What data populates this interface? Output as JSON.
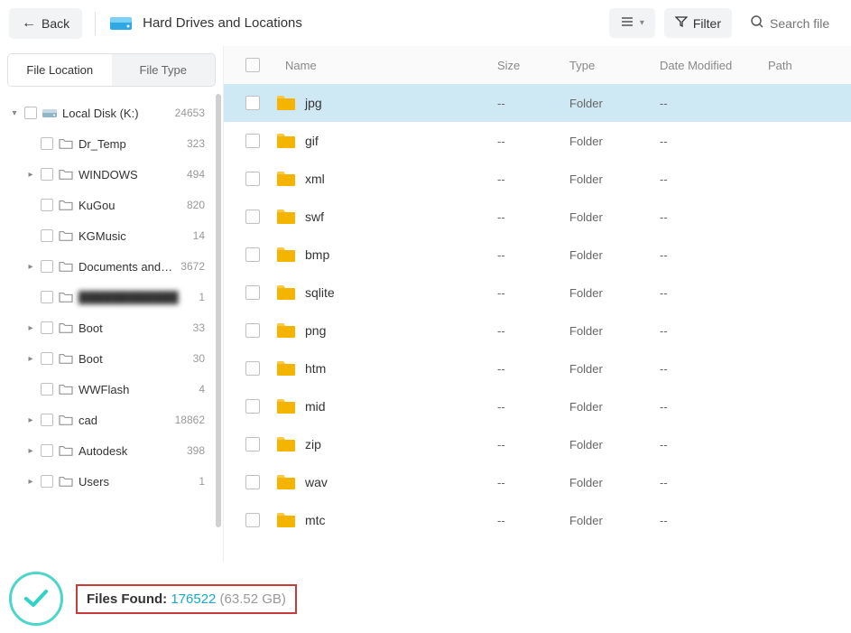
{
  "header": {
    "back_label": "Back",
    "title": "Hard Drives and Locations",
    "filter_label": "Filter",
    "search_placeholder": "Search file"
  },
  "sidebar": {
    "tabs": {
      "location": "File Location",
      "type": "File Type"
    },
    "items": [
      {
        "label": "Local Disk (K:)",
        "count": "24653",
        "icon": "drive",
        "indent": 0,
        "caret": "down"
      },
      {
        "label": "Dr_Temp",
        "count": "323",
        "icon": "folder",
        "indent": 1,
        "caret": ""
      },
      {
        "label": "WINDOWS",
        "count": "494",
        "icon": "folder",
        "indent": 1,
        "caret": "right"
      },
      {
        "label": "KuGou",
        "count": "820",
        "icon": "folder",
        "indent": 1,
        "caret": ""
      },
      {
        "label": "KGMusic",
        "count": "14",
        "icon": "folder",
        "indent": 1,
        "caret": ""
      },
      {
        "label": "Documents and Set...",
        "count": "3672",
        "icon": "folder",
        "indent": 1,
        "caret": "right"
      },
      {
        "label": "████████████",
        "count": "1",
        "icon": "folder",
        "indent": 1,
        "caret": "",
        "blurred": true
      },
      {
        "label": "Boot",
        "count": "33",
        "icon": "folder",
        "indent": 1,
        "caret": "right"
      },
      {
        "label": "Boot",
        "count": "30",
        "icon": "folder",
        "indent": 1,
        "caret": "right"
      },
      {
        "label": "WWFlash",
        "count": "4",
        "icon": "folder",
        "indent": 1,
        "caret": ""
      },
      {
        "label": "cad",
        "count": "18862",
        "icon": "folder",
        "indent": 1,
        "caret": "right"
      },
      {
        "label": "Autodesk",
        "count": "398",
        "icon": "folder",
        "indent": 1,
        "caret": "right"
      },
      {
        "label": "Users",
        "count": "1",
        "icon": "folder",
        "indent": 1,
        "caret": "right"
      }
    ]
  },
  "table": {
    "headers": {
      "name": "Name",
      "size": "Size",
      "type": "Type",
      "date": "Date Modified",
      "path": "Path"
    },
    "rows": [
      {
        "name": "jpg",
        "size": "--",
        "type": "Folder",
        "date": "--",
        "selected": true
      },
      {
        "name": "gif",
        "size": "--",
        "type": "Folder",
        "date": "--"
      },
      {
        "name": "xml",
        "size": "--",
        "type": "Folder",
        "date": "--"
      },
      {
        "name": "swf",
        "size": "--",
        "type": "Folder",
        "date": "--"
      },
      {
        "name": "bmp",
        "size": "--",
        "type": "Folder",
        "date": "--"
      },
      {
        "name": "sqlite",
        "size": "--",
        "type": "Folder",
        "date": "--"
      },
      {
        "name": "png",
        "size": "--",
        "type": "Folder",
        "date": "--"
      },
      {
        "name": "htm",
        "size": "--",
        "type": "Folder",
        "date": "--"
      },
      {
        "name": "mid",
        "size": "--",
        "type": "Folder",
        "date": "--"
      },
      {
        "name": "zip",
        "size": "--",
        "type": "Folder",
        "date": "--"
      },
      {
        "name": "wav",
        "size": "--",
        "type": "Folder",
        "date": "--"
      },
      {
        "name": "mtc",
        "size": "--",
        "type": "Folder",
        "date": "--"
      }
    ]
  },
  "footer": {
    "files_found_label": "Files Found: ",
    "files_found_count": "176522",
    "files_found_size": " (63.52 GB)"
  }
}
